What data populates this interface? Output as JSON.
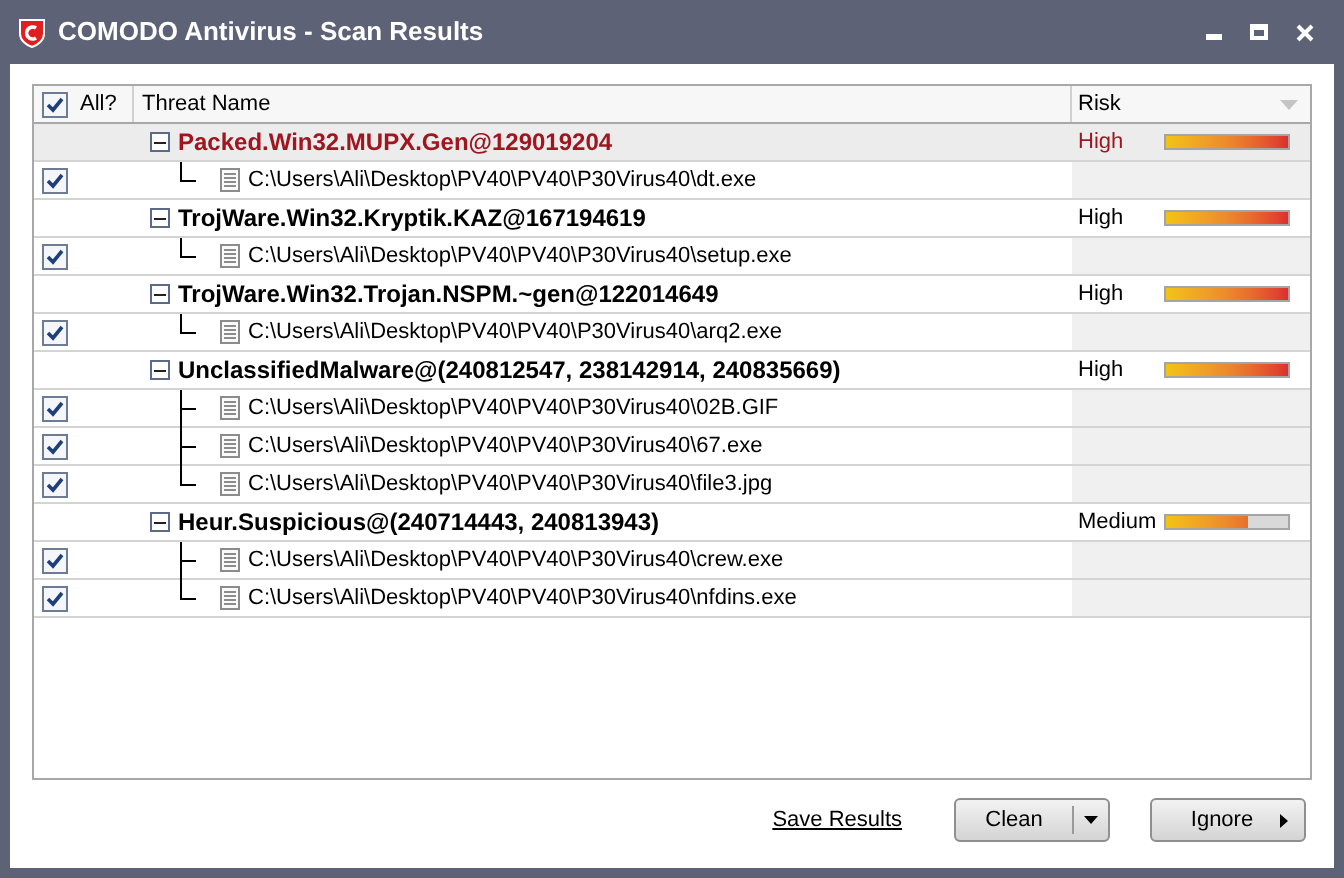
{
  "window": {
    "title": "COMODO Antivirus - Scan Results"
  },
  "table": {
    "all_checkbox": {
      "label": "All?",
      "checked": true
    },
    "columns": [
      "Threat Name",
      "Risk"
    ],
    "groups": [
      {
        "name": "Packed.Win32.MUPX.Gen@129019204",
        "selected": true,
        "expanded": true,
        "risk": "High",
        "level": 1,
        "files": [
          {
            "path": "C:\\Users\\Ali\\Desktop\\PV40\\PV40\\P30Virus40\\dt.exe",
            "checked": true
          }
        ]
      },
      {
        "name": "TrojWare.Win32.Kryptik.KAZ@167194619",
        "selected": false,
        "expanded": true,
        "risk": "High",
        "level": 1,
        "files": [
          {
            "path": "C:\\Users\\Ali\\Desktop\\PV40\\PV40\\P30Virus40\\setup.exe",
            "checked": true
          }
        ]
      },
      {
        "name": "TrojWare.Win32.Trojan.NSPM.~gen@122014649",
        "selected": false,
        "expanded": true,
        "risk": "High",
        "level": 1,
        "files": [
          {
            "path": "C:\\Users\\Ali\\Desktop\\PV40\\PV40\\P30Virus40\\arq2.exe",
            "checked": true
          }
        ]
      },
      {
        "name": "UnclassifiedMalware@(240812547, 238142914, 240835669)",
        "selected": false,
        "expanded": true,
        "risk": "High",
        "level": 1,
        "files": [
          {
            "path": "C:\\Users\\Ali\\Desktop\\PV40\\PV40\\P30Virus40\\02B.GIF",
            "checked": true
          },
          {
            "path": "C:\\Users\\Ali\\Desktop\\PV40\\PV40\\P30Virus40\\67.exe",
            "checked": true
          },
          {
            "path": "C:\\Users\\Ali\\Desktop\\PV40\\PV40\\P30Virus40\\file3.jpg",
            "checked": true
          }
        ]
      },
      {
        "name": "Heur.Suspicious@(240714443, 240813943)",
        "selected": false,
        "expanded": true,
        "risk": "Medium",
        "level": 0.67,
        "files": [
          {
            "path": "C:\\Users\\Ali\\Desktop\\PV40\\PV40\\P30Virus40\\crew.exe",
            "checked": true
          },
          {
            "path": "C:\\Users\\Ali\\Desktop\\PV40\\PV40\\P30Virus40\\nfdins.exe",
            "checked": true
          }
        ]
      }
    ]
  },
  "footer": {
    "link": "Save Results",
    "buttons": [
      {
        "label": "Clean",
        "kind": "dropdown"
      },
      {
        "label": "Ignore",
        "kind": "arrow"
      }
    ]
  }
}
